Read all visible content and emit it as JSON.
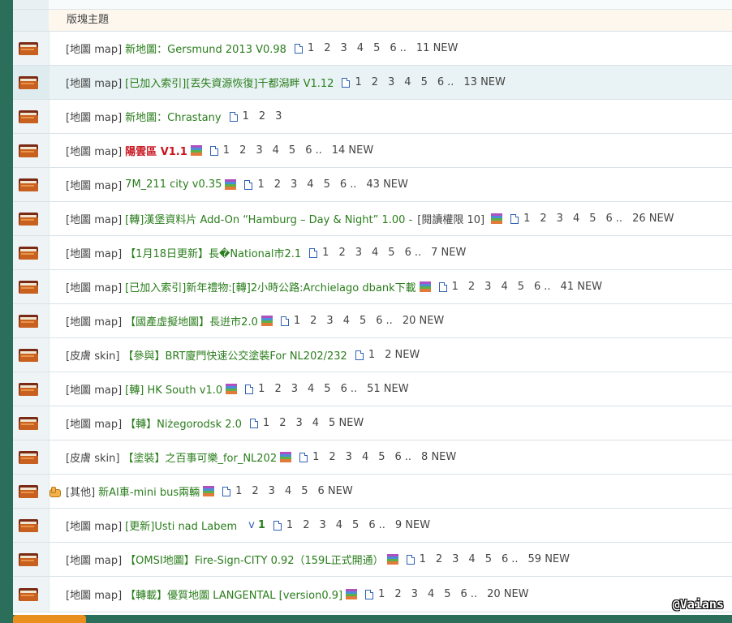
{
  "header": {
    "label": "版塊主題"
  },
  "threads": [
    {
      "cat": "[地圖 map]",
      "title": "新地圖：Gersmund 2013 V0.98",
      "hot": false,
      "rar": false,
      "pages": [
        "1",
        "2",
        "3",
        "4",
        "5",
        "6"
      ],
      "new": "11 NEW",
      "height": 42,
      "highlight": false,
      "thumb": false
    },
    {
      "cat": "[地圖 map]",
      "title": "[已加入索引][丟失資源恢復]千都潟畔 V1.12",
      "hot": false,
      "rar": false,
      "pages": [
        "1",
        "2",
        "3",
        "4",
        "5",
        "6"
      ],
      "new": "13 NEW",
      "height": 42,
      "highlight": true,
      "thumb": false
    },
    {
      "cat": "[地圖 map]",
      "title": "新地圖：Chrastany",
      "hot": false,
      "rar": false,
      "pages": [
        "1",
        "2",
        "3"
      ],
      "new": "",
      "height": 42,
      "highlight": false,
      "thumb": false
    },
    {
      "cat": "[地圖 map]",
      "title": "陽雲區 V1.1",
      "hot": true,
      "rar": true,
      "pages": [
        "1",
        "2",
        "3",
        "4",
        "5",
        "6"
      ],
      "new": "14 NEW",
      "height": 42,
      "highlight": false,
      "thumb": false
    },
    {
      "cat": "[地圖 map]",
      "title": "7M_211 city v0.35",
      "hot": false,
      "rar": true,
      "pages": [
        "1",
        "2",
        "3",
        "4",
        "5",
        "6"
      ],
      "new": "43 NEW",
      "height": 42,
      "highlight": false,
      "thumb": false
    },
    {
      "cat": "[地圖 map]",
      "title": "[轉]漢堡資料片 Add-On “Hamburg – Day & Night” 1.00 -",
      "extra": "[閱讀權限 10]",
      "hot": false,
      "rar": true,
      "pages": [
        "1",
        "2",
        "3",
        "4",
        "5",
        "6"
      ],
      "new": "26 NEW",
      "height": 42,
      "highlight": false,
      "thumb": false
    },
    {
      "cat": "[地圖 map]",
      "title": "【1月18日更新】長�National市2.1",
      "hot": false,
      "rar": false,
      "pages": [
        "1",
        "2",
        "3",
        "4",
        "5",
        "6"
      ],
      "new": "7 NEW",
      "height": 42,
      "highlight": false,
      "thumb": false
    },
    {
      "cat": "[地圖 map]",
      "title": "[已加入索引]新年禮物:[轉]2小時公路:Archielago dbank下載",
      "hot": false,
      "rar": true,
      "pages": [
        "1",
        "2",
        "3",
        "4",
        "5",
        "6"
      ],
      "new": "41 NEW",
      "height": 42,
      "highlight": false,
      "thumb": false
    },
    {
      "cat": "[地圖 map]",
      "title": "【國產虛擬地圖】長逬市2.0",
      "hot": false,
      "rar": true,
      "pages": [
        "1",
        "2",
        "3",
        "4",
        "5",
        "6"
      ],
      "new": "20 NEW",
      "height": 42,
      "highlight": false,
      "thumb": false
    },
    {
      "cat": "[皮膚 skin]",
      "title": "【參與】BRT廈門快速公交塗裝For NL202/232",
      "hot": false,
      "rar": false,
      "pages": [
        "1"
      ],
      "new": "2 NEW",
      "height": 42,
      "highlight": false,
      "thumb": false
    },
    {
      "cat": "[地圖 map]",
      "title": "[轉] HK South v1.0",
      "hot": false,
      "rar": true,
      "pages": [
        "1",
        "2",
        "3",
        "4",
        "5",
        "6"
      ],
      "new": "51 NEW",
      "height": 42,
      "highlight": false,
      "thumb": false
    },
    {
      "cat": "[地圖 map]",
      "title": "【轉】Niżegorodsk 2.0",
      "hot": false,
      "rar": false,
      "pages": [
        "1",
        "2",
        "3",
        "4"
      ],
      "new": "5 NEW",
      "height": 42,
      "highlight": false,
      "thumb": false
    },
    {
      "cat": "[皮膚 skin]",
      "title": "【塗裝】之百事可樂_for_NL202",
      "hot": false,
      "rar": true,
      "pages": [
        "1",
        "2",
        "3",
        "4",
        "5",
        "6"
      ],
      "new": "8 NEW",
      "height": 42,
      "highlight": false,
      "thumb": false
    },
    {
      "cat": "[其他]",
      "title": "新AI車-mini bus兩輛",
      "hot": false,
      "rar": true,
      "pages": [
        "1",
        "2",
        "3",
        "4",
        "5"
      ],
      "new": "6 NEW",
      "height": 42,
      "highlight": false,
      "thumb": true
    },
    {
      "cat": "[地圖 map]",
      "title": "[更新]Usti nad Labem",
      "vmark": "v",
      "vnum": "1",
      "hot": false,
      "rar": false,
      "pages": [
        "1",
        "2",
        "3",
        "4",
        "5",
        "6"
      ],
      "new": "9 NEW",
      "height": 42,
      "highlight": false,
      "thumb": false
    },
    {
      "cat": "[地圖 map]",
      "title": "【OMSI地圖】Fire-Sign-CITY 0.92（159L正式開通）",
      "hot": false,
      "rar": true,
      "pages": [
        "1",
        "2",
        "3",
        "4",
        "5",
        "6"
      ],
      "new": "59 NEW",
      "height": 42,
      "highlight": false,
      "thumb": false
    },
    {
      "cat": "[地圖 map]",
      "title": "【轉載】優質地圖 LANGENTAL [version0.9]",
      "hot": false,
      "rar": true,
      "pages": [
        "1",
        "2",
        "3",
        "4",
        "5",
        "6"
      ],
      "new": "20 NEW",
      "height": 44,
      "highlight": false,
      "thumb": false
    }
  ],
  "pager_dots": "..",
  "watermark": "@Vaians"
}
